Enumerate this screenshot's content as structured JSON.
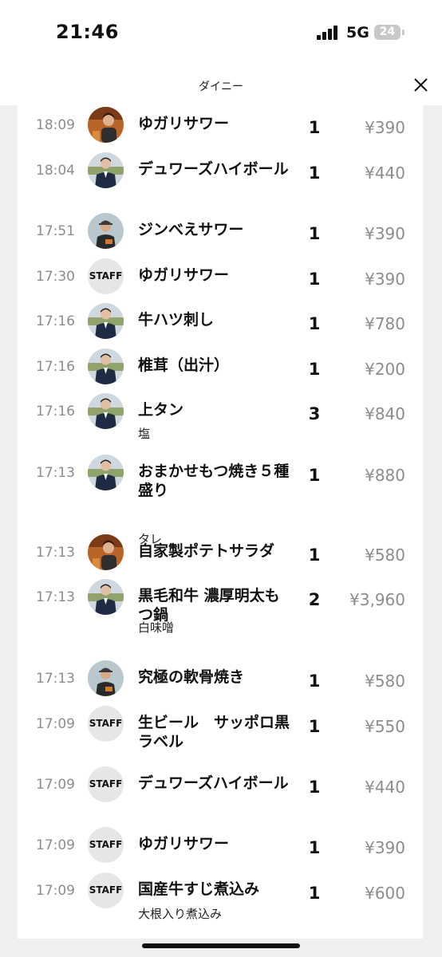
{
  "status_bar": {
    "time": "21:46",
    "network": "5G",
    "battery": "24"
  },
  "header": {
    "title": "ダイニー",
    "close_icon": "close-icon"
  },
  "orders": [
    {
      "time": "18:09",
      "avatar": "photo-orange",
      "name": "ゆガリサワー",
      "note": "",
      "qty": "1",
      "price": "¥390"
    },
    {
      "time": "18:04",
      "avatar": "photo-suit",
      "name": "デュワーズハイボール",
      "note": "",
      "qty": "1",
      "price": "¥440"
    },
    {
      "time": "17:51",
      "avatar": "photo-cap",
      "name": "ジンべえサワー",
      "note": "",
      "qty": "1",
      "price": "¥390"
    },
    {
      "time": "17:30",
      "avatar": "STAFF",
      "name": "ゆガリサワー",
      "note": "",
      "qty": "1",
      "price": "¥390"
    },
    {
      "time": "17:16",
      "avatar": "photo-suit",
      "name": "牛ハツ刺し",
      "note": "",
      "qty": "1",
      "price": "¥780"
    },
    {
      "time": "17:16",
      "avatar": "photo-suit",
      "name": "椎茸（出汁）",
      "note": "",
      "qty": "1",
      "price": "¥200"
    },
    {
      "time": "17:16",
      "avatar": "photo-suit",
      "name": "上タン",
      "note": "塩",
      "qty": "3",
      "price": "¥840"
    },
    {
      "time": "17:13",
      "avatar": "photo-suit",
      "name": "おまかせもつ焼き５種盛り",
      "note": "タレ",
      "qty": "1",
      "price": "¥880"
    },
    {
      "time": "17:13",
      "avatar": "photo-orange",
      "name": "自家製ポテトサラダ",
      "note": "",
      "qty": "1",
      "price": "¥580"
    },
    {
      "time": "17:13",
      "avatar": "photo-suit",
      "name": "黒毛和牛 濃厚明太もつ鍋",
      "note": "白味噌",
      "qty": "2",
      "price": "¥3,960"
    },
    {
      "time": "17:13",
      "avatar": "photo-cap",
      "name": "究極の軟骨焼き",
      "note": "",
      "qty": "1",
      "price": "¥580"
    },
    {
      "time": "17:09",
      "avatar": "STAFF",
      "name": "生ビール　サッポロ黒ラベル",
      "note": "",
      "qty": "1",
      "price": "¥550"
    },
    {
      "time": "17:09",
      "avatar": "STAFF",
      "name": "デュワーズハイボール",
      "note": "",
      "qty": "1",
      "price": "¥440"
    },
    {
      "time": "17:09",
      "avatar": "STAFF",
      "name": "ゆガリサワー",
      "note": "",
      "qty": "1",
      "price": "¥390"
    },
    {
      "time": "17:09",
      "avatar": "STAFF",
      "name": "国産牛すじ煮込み",
      "note": "大根入り煮込み",
      "qty": "1",
      "price": "¥600"
    }
  ]
}
